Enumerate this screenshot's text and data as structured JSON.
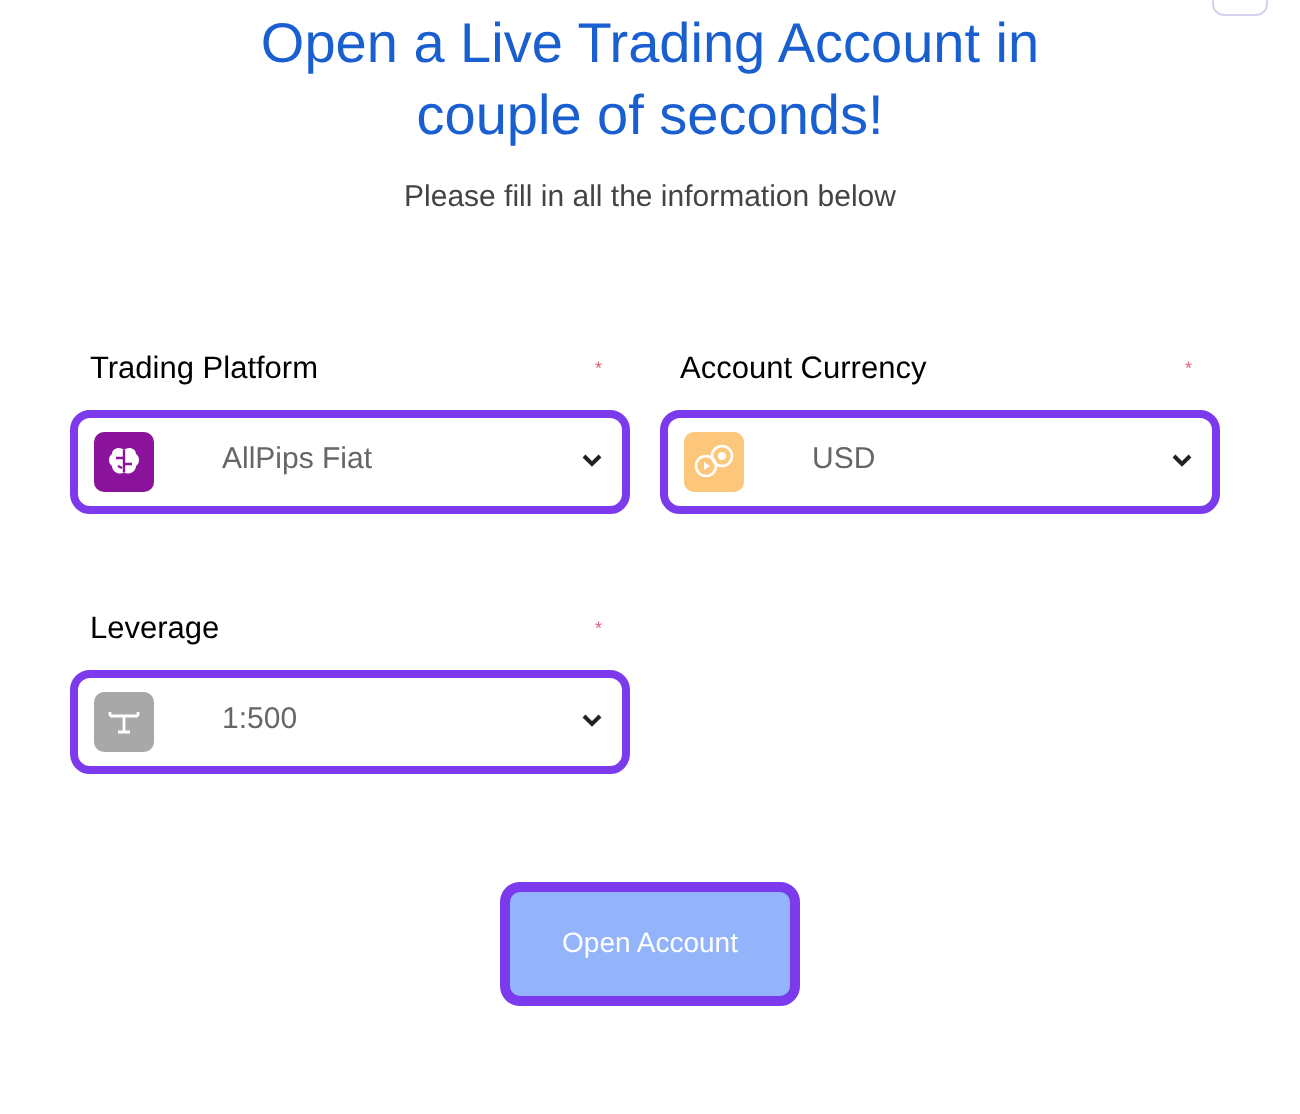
{
  "heading": "Open a Live Trading Account in couple of seconds!",
  "subtitle": "Please fill in all the information below",
  "fields": [
    {
      "label": "Trading Platform",
      "required_mark": "*",
      "kind": "brain",
      "value": "AllPips Fiat"
    },
    {
      "label": "Account Currency",
      "required_mark": "*",
      "kind": "coins",
      "value": "USD"
    },
    {
      "label": "Leverage",
      "required_mark": "*",
      "kind": "leverage",
      "value": "1:500"
    }
  ],
  "submit_button": "Open Account"
}
